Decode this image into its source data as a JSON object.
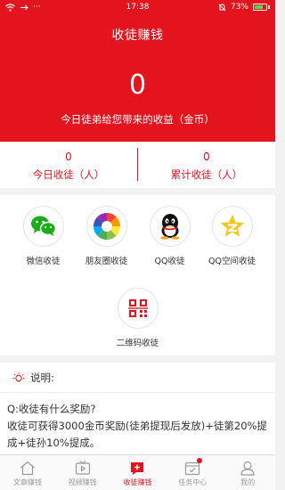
{
  "status_bar": {
    "time": "17:38",
    "battery": "73%",
    "dots": "···"
  },
  "header": {
    "title": "收徒赚钱",
    "today_income_value": "0",
    "today_income_caption": "今日徒弟给您带来的收益（金币）"
  },
  "stats": {
    "today_apprentices": {
      "value": "0",
      "label": "今日收徒（人）"
    },
    "total_apprentices": {
      "value": "0",
      "label": "累计收徒（人）"
    }
  },
  "share_channels": [
    {
      "label": "微信收徒",
      "icon": "wechat-icon"
    },
    {
      "label": "朋友圈收徒",
      "icon": "moments-icon"
    },
    {
      "label": "QQ收徒",
      "icon": "qq-icon"
    },
    {
      "label": "QQ空间收徒",
      "icon": "qzone-icon"
    },
    {
      "label": "二维码收徒",
      "icon": "qrcode-icon"
    }
  ],
  "info": {
    "title": "说明:",
    "question": "Q:收徒有什么奖励?",
    "answer": "收徒可获得3000金币奖励(徒弟提现后发放)+徒第20%提成+徒孙10%提成。"
  },
  "tabs": [
    {
      "label": "文章赚钱",
      "icon": "home-icon"
    },
    {
      "label": "视频赚钱",
      "icon": "video-icon"
    },
    {
      "label": "收徒赚钱",
      "icon": "apprentice-icon",
      "active": true
    },
    {
      "label": "任务中心",
      "icon": "task-icon",
      "badge": true
    },
    {
      "label": "我的",
      "icon": "profile-icon"
    }
  ],
  "colors": {
    "brand_red": "#e4141e",
    "wechat_green": "#1aad19",
    "qzone_yellow": "#f5c518"
  }
}
